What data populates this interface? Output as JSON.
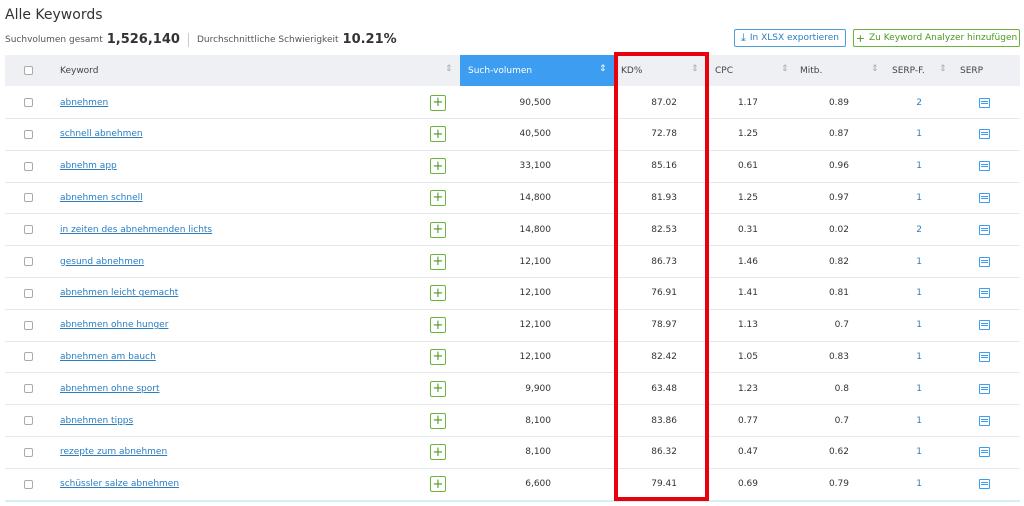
{
  "page": {
    "title": "Alle Keywords",
    "total_volume_label": "Suchvolumen gesamt",
    "total_volume_value": "1,526,140",
    "avg_difficulty_label": "Durchschnittliche Schwierigkeit",
    "avg_difficulty_value": "10.21%"
  },
  "toolbar": {
    "export_label": "In XLSX exportieren",
    "analyzer_label": "Zu Keyword Analyzer hinzufügen"
  },
  "table": {
    "headers": {
      "keyword": "Keyword",
      "volume": "Such-volumen",
      "kd": "KD%",
      "cpc": "CPC",
      "competition": "Mitb.",
      "serp_features": "SERP-F.",
      "serp": "SERP"
    },
    "rows": [
      {
        "keyword": "abnehmen",
        "volume": "90,500",
        "kd": "87.02",
        "cpc": "1.17",
        "competition": "0.89",
        "serp_features": "2"
      },
      {
        "keyword": "schnell abnehmen",
        "volume": "40,500",
        "kd": "72.78",
        "cpc": "1.25",
        "competition": "0.87",
        "serp_features": "1"
      },
      {
        "keyword": "abnehm app",
        "volume": "33,100",
        "kd": "85.16",
        "cpc": "0.61",
        "competition": "0.96",
        "serp_features": "1"
      },
      {
        "keyword": "abnehmen schnell",
        "volume": "14,800",
        "kd": "81.93",
        "cpc": "1.25",
        "competition": "0.97",
        "serp_features": "1"
      },
      {
        "keyword": "in zeiten des abnehmenden lichts",
        "volume": "14,800",
        "kd": "82.53",
        "cpc": "0.31",
        "competition": "0.02",
        "serp_features": "2"
      },
      {
        "keyword": "gesund abnehmen",
        "volume": "12,100",
        "kd": "86.73",
        "cpc": "1.46",
        "competition": "0.82",
        "serp_features": "1"
      },
      {
        "keyword": "abnehmen leicht gemacht",
        "volume": "12,100",
        "kd": "76.91",
        "cpc": "1.41",
        "competition": "0.81",
        "serp_features": "1"
      },
      {
        "keyword": "abnehmen ohne hunger",
        "volume": "12,100",
        "kd": "78.97",
        "cpc": "1.13",
        "competition": "0.7",
        "serp_features": "1"
      },
      {
        "keyword": "abnehmen am bauch",
        "volume": "12,100",
        "kd": "82.42",
        "cpc": "1.05",
        "competition": "0.83",
        "serp_features": "1"
      },
      {
        "keyword": "abnehmen ohne sport",
        "volume": "9,900",
        "kd": "63.48",
        "cpc": "1.23",
        "competition": "0.8",
        "serp_features": "1"
      },
      {
        "keyword": "abnehmen tipps",
        "volume": "8,100",
        "kd": "83.86",
        "cpc": "0.77",
        "competition": "0.7",
        "serp_features": "1"
      },
      {
        "keyword": "rezepte zum abnehmen",
        "volume": "8,100",
        "kd": "86.32",
        "cpc": "0.47",
        "competition": "0.62",
        "serp_features": "1"
      },
      {
        "keyword": "schüssler salze abnehmen",
        "volume": "6,600",
        "kd": "79.41",
        "cpc": "0.69",
        "competition": "0.79",
        "serp_features": "1"
      }
    ]
  },
  "icons": {
    "export": "download-icon",
    "analyzer": "plus-icon",
    "add_row": "plus-icon",
    "serp": "serp-snapshot-icon",
    "sort": "sort-icon"
  },
  "colors": {
    "link": "#2a7dc0",
    "active_header": "#3d9df0",
    "green": "#6cb33e",
    "highlight": "#e8000d"
  }
}
